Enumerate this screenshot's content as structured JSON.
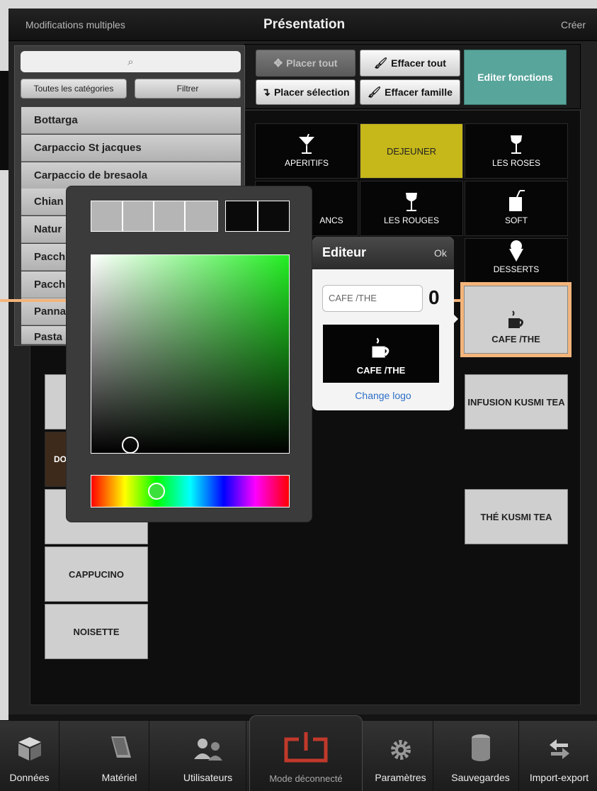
{
  "topbar": {
    "left_label": "Modifications multiples",
    "title": "Présentation",
    "right_label": "Créer"
  },
  "search": {
    "icon": "search-icon",
    "placeholder": ""
  },
  "filters": {
    "categories_label": "Toutes les catégories",
    "filter_label": "Filtrer"
  },
  "list": {
    "items": [
      "Bottarga",
      "Carpaccio St jacques",
      "Carpaccio de bresaola",
      "Chian",
      "Natur",
      "Pacch",
      "Pacch",
      "Panna",
      "Pasta"
    ]
  },
  "toolbar": {
    "placer_tout": "Placer tout",
    "effacer_tout": "Effacer tout",
    "placer_selection": "Placer sélection",
    "effacer_famille": "Effacer famille",
    "editer_fonctions": "Editer fonctions"
  },
  "grid": {
    "aperitifs": "APERITIFS",
    "dejeuner": "DEJEUNER",
    "les_roses": "LES ROSES",
    "blancs": "ANCS",
    "les_rouges": "LES ROUGES",
    "soft": "SOFT",
    "desserts": "DESSERTS",
    "cafe_the": "CAFE /THE",
    "infusion": "INFUSION KUSMI TEA",
    "the_kusmi": "THÉ KUSMI TEA",
    "do": "DO",
    "cappucino": "CAPPUCINO",
    "noisette": "NOISETTE"
  },
  "editor": {
    "title": "Editeur",
    "ok": "Ok",
    "field_value": "CAFE /THE",
    "number": "0",
    "preview_label": "CAFE /THE",
    "change_logo": "Change logo"
  },
  "color_picker": {
    "selected_color": "#0a0a0a",
    "hue_color": "#22ee22",
    "recent_colors": [
      "#b5b5b5",
      "#b5b5b5",
      "#b5b5b5",
      "#b5b5b5"
    ]
  },
  "tabs": [
    {
      "label": "Données",
      "icon": "cube-icon"
    },
    {
      "label": "Matériel",
      "icon": "terminal-icon"
    },
    {
      "label": "Utilisateurs",
      "icon": "users-icon"
    },
    {
      "label": "Mode déconnecté",
      "icon": "power-icon"
    },
    {
      "label": "Paramètres",
      "icon": "gear-icon"
    },
    {
      "label": "Sauvegardes",
      "icon": "database-icon"
    },
    {
      "label": "Import-export",
      "icon": "arrows-icon"
    }
  ],
  "colors": {
    "accent_teal": "#58a59b",
    "tile_yellow": "#c6b71a",
    "highlight_orange": "#f3b47b",
    "link_blue": "#2d6fc6",
    "power_red": "#c0392b"
  }
}
